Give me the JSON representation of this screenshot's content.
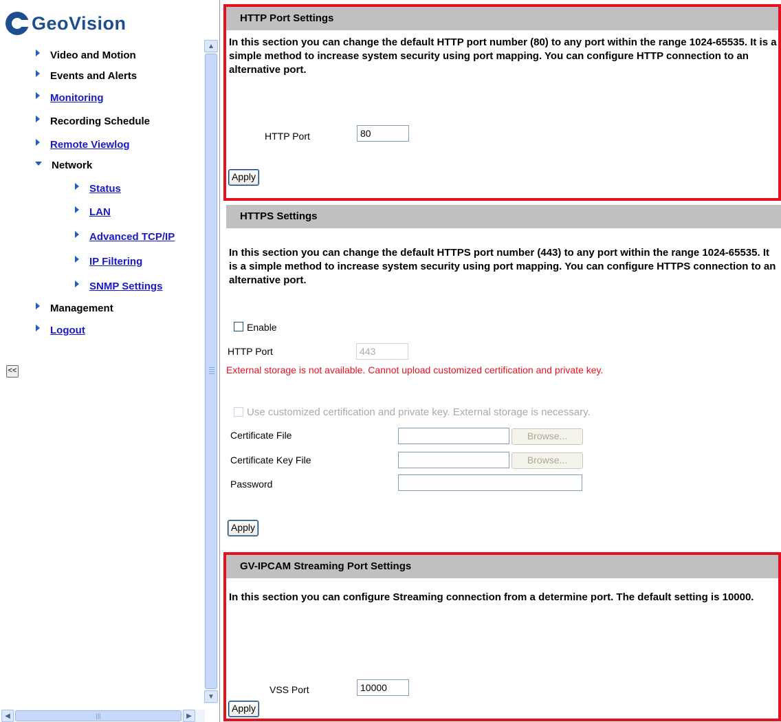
{
  "brand": {
    "logo_text": "GeoVision"
  },
  "nav": {
    "items": [
      {
        "label": "Video and Motion",
        "link": false
      },
      {
        "label": "Events and Alerts",
        "link": false
      },
      {
        "label": "Monitoring",
        "link": true
      },
      {
        "label": "Recording Schedule",
        "link": false
      },
      {
        "label": "Remote Viewlog",
        "link": true
      },
      {
        "label": "Network",
        "link": false,
        "expanded": true
      },
      {
        "label": "Status",
        "link": true,
        "child": true
      },
      {
        "label": "LAN",
        "link": true,
        "child": true
      },
      {
        "label": "Advanced TCP/IP",
        "link": true,
        "child": true
      },
      {
        "label": "IP Filtering",
        "link": true,
        "child": true
      },
      {
        "label": "SNMP Settings",
        "link": true,
        "child": true
      },
      {
        "label": "Management",
        "link": false
      },
      {
        "label": "Logout",
        "link": true
      }
    ],
    "collapse_label": "<<"
  },
  "http_section": {
    "title": "HTTP Port Settings",
    "description": "In this section you can change the default HTTP port number (80) to any port within the range 1024-65535. It is a simple method to increase system security using port mapping. You can configure HTTP connection to an alternative port.",
    "port_label": "HTTP Port",
    "port_value": "80",
    "apply_label": "Apply"
  },
  "https_section": {
    "title": "HTTPS Settings",
    "description": "In this section you can change the default HTTPS port number (443) to any port within the range 1024-65535. It is a simple method to increase system security using port mapping. You can configure HTTPS connection to an alternative port.",
    "enable_label": "Enable",
    "enable_checked": false,
    "port_label": "HTTP Port",
    "port_value": "443",
    "warning": "External storage is not available. Cannot upload customized certification and private key.",
    "custom_cert_label": "Use customized certification and private key. External storage is necessary.",
    "cert_file_label": "Certificate File",
    "cert_key_label": "Certificate Key File",
    "password_label": "Password",
    "browse_label": "Browse...",
    "apply_label": "Apply"
  },
  "streaming_section": {
    "title": "GV-IPCAM Streaming Port Settings",
    "description": "In this section you can configure Streaming connection from a determine port. The default setting is 10000.",
    "port_label": "VSS Port",
    "port_value": "10000",
    "apply_label": "Apply"
  },
  "colors": {
    "frame_red": "#e3121e",
    "header_grey": "#c0c0c0",
    "link_blue": "#1818cc",
    "brand_blue": "#1d4e8f"
  }
}
